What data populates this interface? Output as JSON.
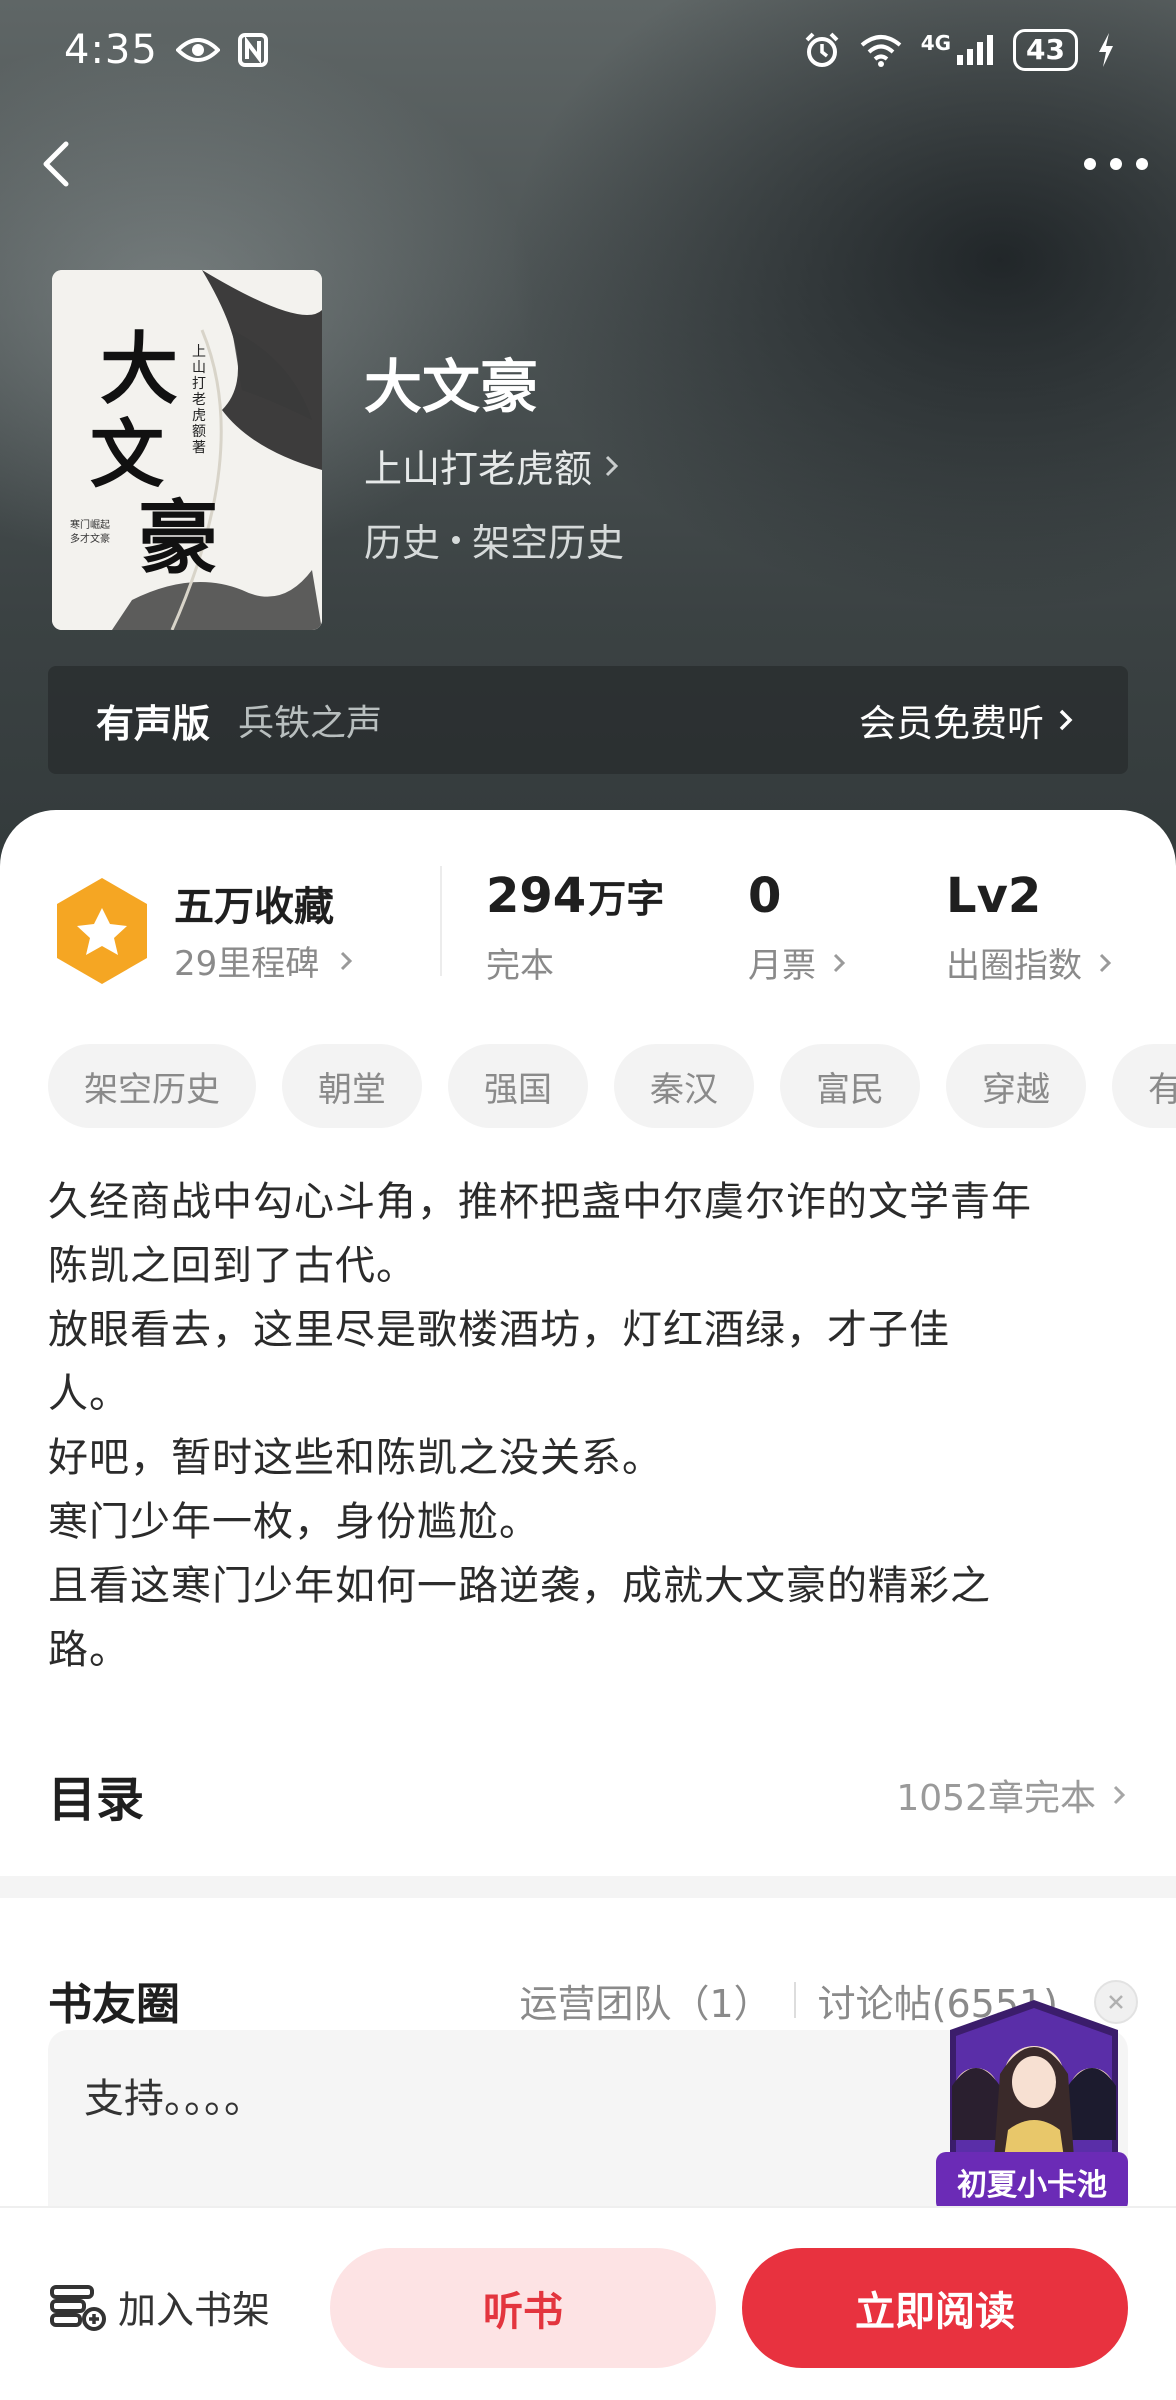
{
  "status_bar": {
    "time": "4:35",
    "battery": "43",
    "network": "4G",
    "icons": [
      "eye-icon",
      "nfc-icon",
      "alarm-icon",
      "wifi-icon",
      "signal-icon",
      "battery-icon",
      "charging-icon"
    ]
  },
  "nav": {
    "back_icon": "chevron-left-icon",
    "more_icon": "more-dots-icon"
  },
  "book": {
    "title": "大文豪",
    "author": "上山打老虎额",
    "category": "历史",
    "subcategory": "架空历史",
    "cover_title": "大文豪",
    "cover_author": "上山打老虎额 著",
    "cover_caption": "寒门崛起 多才文豪"
  },
  "audio": {
    "label": "有声版",
    "narrator": "兵铁之声",
    "action": "会员免费听"
  },
  "stats": {
    "collect_title": "五万收藏",
    "collect_sub": "29里程碑",
    "words_value": "294",
    "words_unit": "万字",
    "words_label": "完本",
    "tickets_value": "0",
    "tickets_label": "月票",
    "level_value": "Lv2",
    "level_label": "出圈指数"
  },
  "tags": [
    "架空历史",
    "朝堂",
    "强国",
    "秦汉",
    "富民",
    "穿越",
    "有"
  ],
  "description": [
    "久经商战中勾心斗角，推杯把盏中尔虞尔诈的文学青年",
    "陈凯之回到了古代。",
    "放眼看去，这里尽是歌楼酒坊，灯红酒绿，才子佳",
    "人。",
    "好吧，暂时这些和陈凯之没关系。",
    "寒门少年一枚，身份尴尬。",
    "且看这寒门少年如何一路逆袭，成就大文豪的精彩之",
    "路。"
  ],
  "toc": {
    "title": "目录",
    "summary": "1052章完本"
  },
  "circle": {
    "title": "书友圈",
    "team": "运营团队（1）",
    "posts": "讨论帖(6551)",
    "latest_post": "支持。。。。"
  },
  "promo": {
    "label": "初夏小卡池"
  },
  "bottom": {
    "shelf": "加入书架",
    "listen": "听书",
    "read": "立即阅读"
  },
  "colors": {
    "accent": "#e8323f",
    "accent_light": "#fde3e4",
    "badge": "#f5a623",
    "promo": "#6b2bb6"
  }
}
